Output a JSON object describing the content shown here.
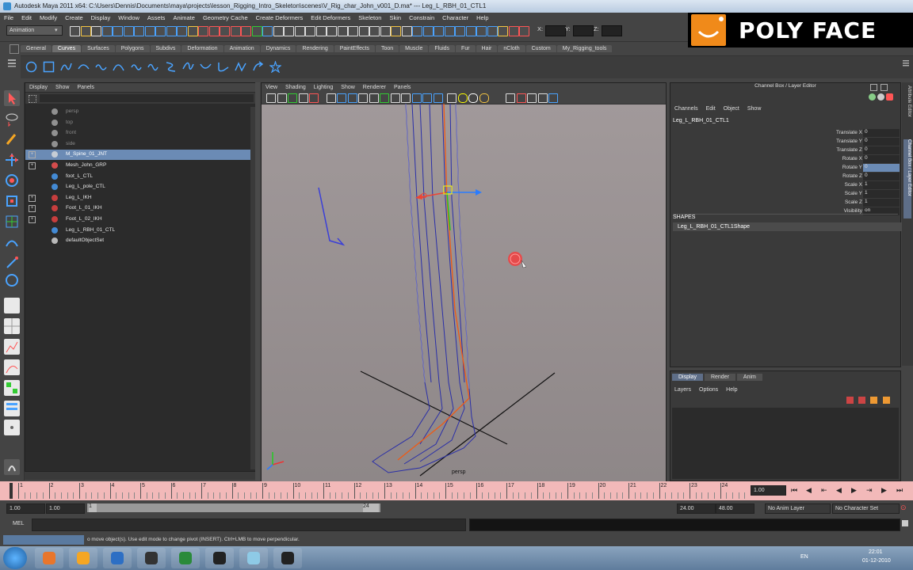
{
  "window": {
    "title": "Autodesk Maya 2011 x64: C:\\Users\\Dennis\\Documents\\maya\\projects\\lesson_Rigging_Intro_Skeleton\\scenes\\V_Rig_char_John_v001_D.ma*    ---    Leg_L_RBH_01_CTL1"
  },
  "menu": [
    "File",
    "Edit",
    "Modify",
    "Create",
    "Display",
    "Window",
    "Assets",
    "Animate",
    "Geometry Cache",
    "Create Deformers",
    "Edit Deformers",
    "Skeleton",
    "Skin",
    "Constrain",
    "Character",
    "Help"
  ],
  "statusline": {
    "mode": "Animation",
    "x_label": "X:",
    "y_label": "Y:",
    "z_label": "Z:"
  },
  "logo": {
    "text": "POLY FACE",
    "color": "#f08a1a"
  },
  "shelf": {
    "tabs": [
      "General",
      "Curves",
      "Surfaces",
      "Polygons",
      "Subdivs",
      "Deformation",
      "Animation",
      "Dynamics",
      "Rendering",
      "PaintEffects",
      "Toon",
      "Muscle",
      "Fluids",
      "Fur",
      "Hair",
      "nCloth",
      "Custom",
      "My_Rigging_tools"
    ],
    "active": "Curves"
  },
  "outliner": {
    "menu": [
      "Display",
      "Show",
      "Panels"
    ],
    "items": [
      {
        "label": "persp",
        "dim": true,
        "icon": "camera-icon"
      },
      {
        "label": "top",
        "dim": true,
        "icon": "camera-icon"
      },
      {
        "label": "front",
        "dim": true,
        "icon": "camera-icon"
      },
      {
        "label": "side",
        "dim": true,
        "icon": "camera-icon"
      },
      {
        "label": "M_Spine_01_JNT",
        "selected": true,
        "expand": true,
        "icon": "joint-icon"
      },
      {
        "label": "Mesh_John_GRP",
        "expand": true,
        "icon": "group-icon"
      },
      {
        "label": "foot_L_CTL",
        "icon": "curve-icon"
      },
      {
        "label": "Leg_L_pole_CTL",
        "icon": "curve-icon"
      },
      {
        "label": "Leg_L_IKH",
        "expand": true,
        "icon": "ik-handle-icon"
      },
      {
        "label": "Foot_L_01_IKH",
        "expand": true,
        "icon": "ik-handle-icon"
      },
      {
        "label": "Foot_L_02_IKH",
        "expand": true,
        "icon": "ik-handle-icon"
      },
      {
        "label": "Leg_L_RBH_01_CTL",
        "icon": "curve-icon"
      },
      {
        "label": "defaultObjectSet",
        "icon": "set-icon"
      }
    ]
  },
  "viewport": {
    "menu": [
      "View",
      "Shading",
      "Lighting",
      "Show",
      "Renderer",
      "Panels"
    ],
    "camera_label": "persp"
  },
  "channelbox": {
    "title": "Channel Box / Layer Editor",
    "menu": [
      "Channels",
      "Edit",
      "Object",
      "Show"
    ],
    "object": "Leg_L_RBH_01_CTL1",
    "attributes": [
      {
        "name": "Translate X",
        "value": "0"
      },
      {
        "name": "Translate Y",
        "value": "0"
      },
      {
        "name": "Translate Z",
        "value": "0"
      },
      {
        "name": "Rotate X",
        "value": "0"
      },
      {
        "name": "Rotate Y",
        "value": "0",
        "highlight": true
      },
      {
        "name": "Rotate Z",
        "value": "0"
      },
      {
        "name": "Scale X",
        "value": "1"
      },
      {
        "name": "Scale Y",
        "value": "1"
      },
      {
        "name": "Scale Z",
        "value": "1"
      },
      {
        "name": "Visibility",
        "value": "on"
      }
    ],
    "shapes_header": "SHAPES",
    "shape": "Leg_L_RBH_01_CTL1Shape",
    "side_tabs": [
      "Attribute Editor",
      "Channel Box / Layer Editor"
    ]
  },
  "layereditor": {
    "tabs": [
      "Display",
      "Render",
      "Anim"
    ],
    "active": "Display",
    "menu": [
      "Layers",
      "Options",
      "Help"
    ]
  },
  "timeslider": {
    "ticks": [
      "1",
      "2",
      "3",
      "4",
      "5",
      "6",
      "7",
      "8",
      "9",
      "10",
      "11",
      "12",
      "13",
      "14",
      "15",
      "16",
      "17",
      "18",
      "19",
      "20",
      "21",
      "22",
      "23",
      "24"
    ],
    "current": "1.00"
  },
  "rangeslider": {
    "start": "1.00",
    "start2": "1.00",
    "range_start": "1",
    "range_end": "24",
    "end": "24.00",
    "end2": "48.00",
    "anim_layer": "No Anim Layer",
    "character_set": "No Character Set"
  },
  "cmdline": {
    "label": "MEL"
  },
  "helpline": {
    "text": "o move object(s). Use edit mode to change pivot (INSERT). Ctrl+LMB to move perpendicular."
  },
  "taskbar": {
    "apps": [
      "firefox-icon",
      "illustrator-icon",
      "photoshop-icon",
      "maya-icon",
      "chrome-icon",
      "explorer-icon",
      "folder-icon",
      "tool-icon"
    ],
    "lang": "EN",
    "time": "22:01",
    "date": "01-12-2010"
  }
}
